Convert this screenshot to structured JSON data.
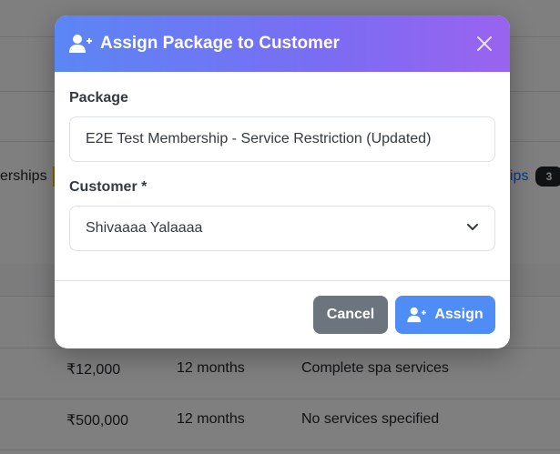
{
  "background": {
    "tab_fragment": "erships",
    "tab_fragment_right": "ips",
    "badge_count": "3",
    "rows": [
      {
        "price": "₹12,000",
        "duration": "12 months",
        "services": "Complete spa services"
      },
      {
        "price": "₹500,000",
        "duration": "12 months",
        "services": "No services specified"
      }
    ]
  },
  "modal": {
    "title": "Assign Package to Customer",
    "title_icon": "user-plus-icon",
    "close_icon": "close-icon",
    "package_label": "Package",
    "package_value": "E2E Test Membership - Service Restriction (Updated)",
    "customer_label": "Customer *",
    "customer_value": "Shivaaaa Yalaaaa",
    "cancel_label": "Cancel",
    "assign_label": "Assign"
  },
  "colors": {
    "header_gradient_start": "#5b86f5",
    "header_gradient_end": "#9a63ef",
    "cancel_button": "#6c757d",
    "assign_button": "#4f8cf5"
  }
}
